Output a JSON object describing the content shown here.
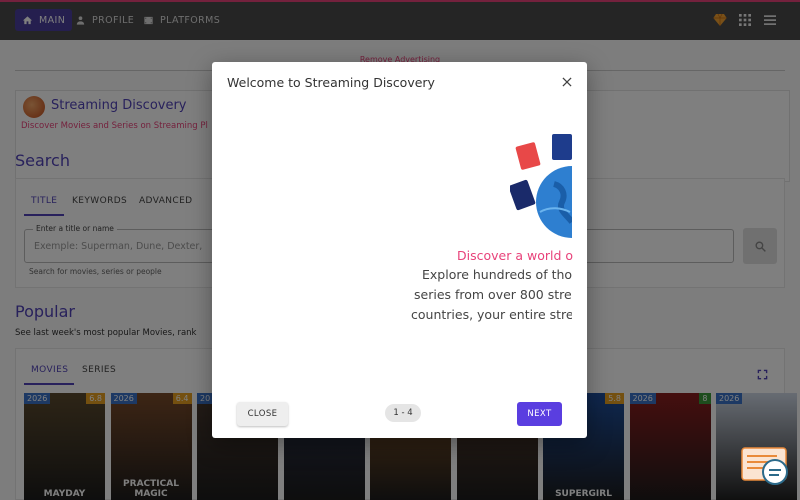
{
  "nav": {
    "items": [
      {
        "label": "MAIN",
        "icon": "home-icon"
      },
      {
        "label": "PROFILE",
        "icon": "person-icon"
      },
      {
        "label": "PLATFORMS",
        "icon": "film-icon"
      }
    ],
    "right_icons": [
      "diamond-icon",
      "apps-grid-icon",
      "menu-icon"
    ]
  },
  "ads": {
    "remove_label": "Remove Advertising"
  },
  "brand": {
    "title": "Streaming Discovery",
    "subtitle": "Discover Movies and Series on Streaming Pl"
  },
  "search": {
    "heading": "Search",
    "tabs": [
      "TITLE",
      "KEYWORDS",
      "ADVANCED"
    ],
    "field_label": "Enter a title or name",
    "placeholder": "Exemple: Superman, Dune, Dexter,",
    "help": "Search for movies, series or people"
  },
  "popular": {
    "heading": "Popular",
    "subtitle": "See last week's most popular Movies, rank",
    "tabs": [
      "MOVIES",
      "SERIES"
    ],
    "posters": [
      {
        "year": "2026",
        "rating": "6.8",
        "title": "MAYDAY",
        "color": "#5b4a2e"
      },
      {
        "year": "2026",
        "rating": "6.4",
        "title": "PRACTICAL MAGIC",
        "color": "#7a4b2a"
      },
      {
        "year": "20",
        "rating": "",
        "title": "",
        "color": "#4a3a30"
      },
      {
        "year": "",
        "rating": "",
        "title": "",
        "color": "#2d3550"
      },
      {
        "year": "",
        "rating": "",
        "title": "",
        "color": "#8a5a2a"
      },
      {
        "year": "",
        "rating": "",
        "title": "",
        "color": "#5a4030"
      },
      {
        "year": "",
        "rating": "5.8",
        "title": "SUPERGIRL",
        "color": "#1e4f9e"
      },
      {
        "year": "2026",
        "rating": "8",
        "title": "",
        "color": "#8a1e1e"
      },
      {
        "year": "2026",
        "rating": "",
        "title": "",
        "color": "#cfd8e6"
      }
    ]
  },
  "modal": {
    "title": "Welcome to Streaming Discovery",
    "heading": "Discover a world o",
    "lines": [
      "Explore hundreds of tho",
      "series from over 800 stre",
      "countries, your entire stre"
    ],
    "close_label": "CLOSE",
    "pager": "1 - 4",
    "next_label": "NEXT"
  },
  "colors": {
    "accent": "#5143b8",
    "pink": "#e8427a",
    "next_button": "#5a3ee0"
  }
}
